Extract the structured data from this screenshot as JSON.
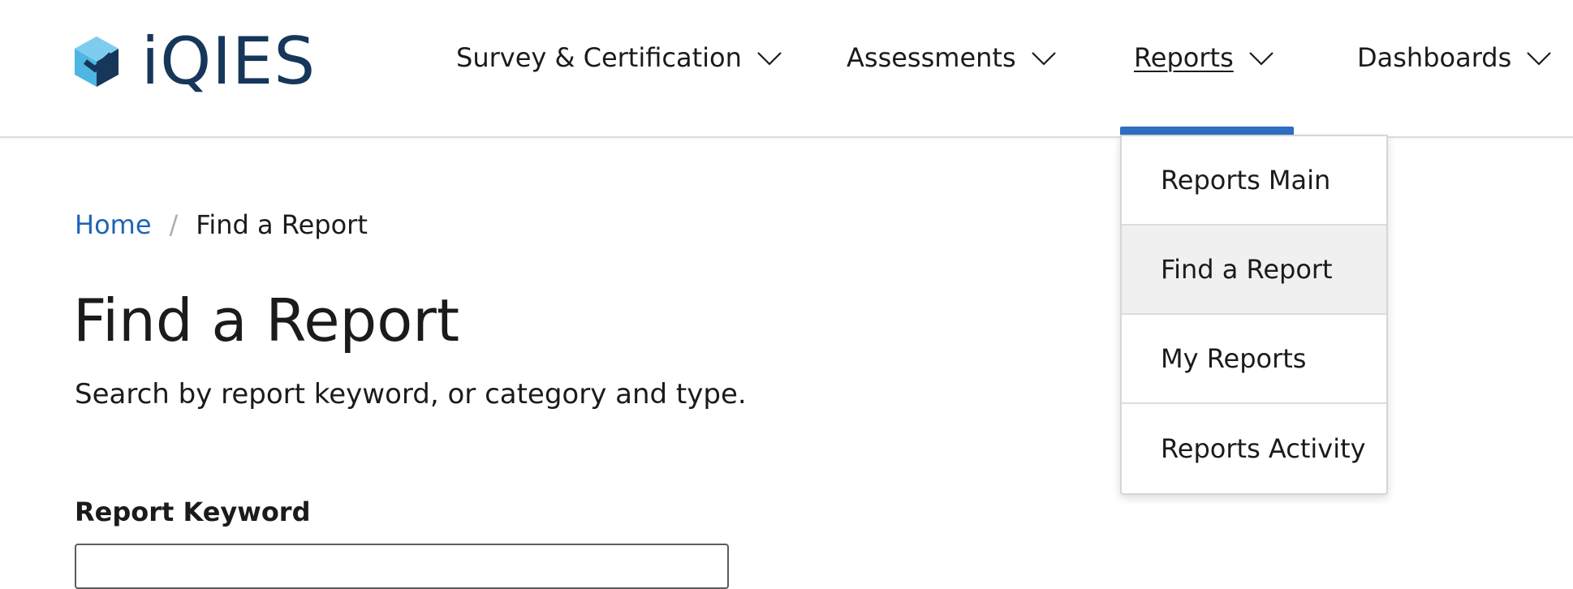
{
  "header": {
    "logo_text": "iQIES",
    "logo_icon": "cube-check-logo-icon",
    "nav": [
      {
        "label": "Survey & Certification",
        "icon": "chevron-down-icon"
      },
      {
        "label": "Assessments",
        "icon": "chevron-down-icon"
      },
      {
        "label": "Reports",
        "icon": "chevron-down-icon",
        "active": true
      },
      {
        "label": "Dashboards",
        "icon": "chevron-down-icon"
      }
    ]
  },
  "reports_menu": {
    "items": [
      {
        "label": "Reports Main"
      },
      {
        "label": "Find a Report",
        "highlighted": true
      },
      {
        "label": "My Reports"
      },
      {
        "label": "Reports Activity"
      }
    ]
  },
  "breadcrumb": {
    "home": "Home",
    "separator": "/",
    "current": "Find a Report"
  },
  "main": {
    "title": "Find a Report",
    "subtitle": "Search by report keyword, or category and type.",
    "keyword_label": "Report Keyword",
    "keyword_value": ""
  },
  "colors": {
    "brand_navy": "#16365a",
    "logo_light": "#4fb6e3",
    "active_accent": "#2e6fc2",
    "link_blue": "#2065b8",
    "menu_highlight": "#f0f0f0"
  }
}
